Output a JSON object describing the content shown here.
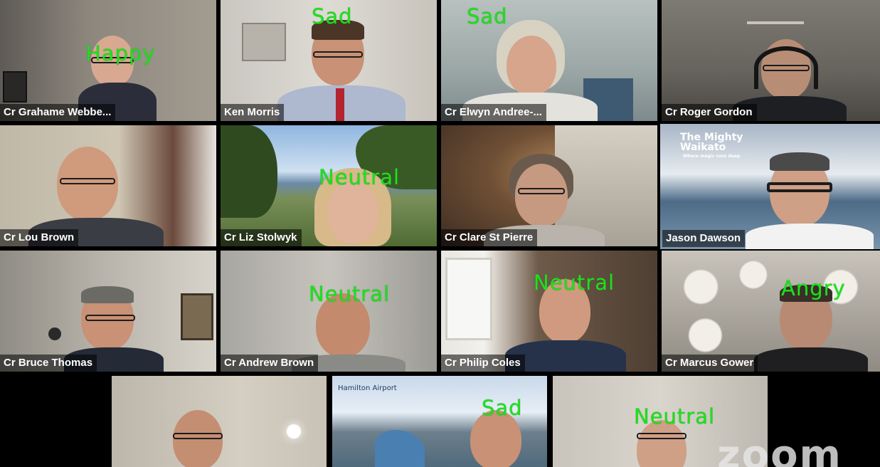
{
  "app": {
    "watermark": "zoom",
    "active_border_color": "#7ed321",
    "emotion_label_color": "#1ee01e"
  },
  "participants": [
    {
      "name": "Cr Grahame Webbe...",
      "emotion": "Happy"
    },
    {
      "name": "Ken Morris",
      "emotion": "Sad"
    },
    {
      "name": "Cr Elwyn Andree-...",
      "emotion": "Sad"
    },
    {
      "name": "Cr Roger Gordon",
      "emotion": ""
    },
    {
      "name": "Cr Lou Brown",
      "emotion": ""
    },
    {
      "name": "Cr Liz Stolwyk",
      "emotion": "Neutral"
    },
    {
      "name": "Cr Clare St Pierre",
      "emotion": ""
    },
    {
      "name": "Jason Dawson",
      "emotion": "",
      "active_speaker": true,
      "background_text": {
        "title": "The Mighty Waikato",
        "tagline": "Where magic runs deep"
      }
    },
    {
      "name": "Cr Bruce Thomas",
      "emotion": ""
    },
    {
      "name": "Cr Andrew Brown",
      "emotion": "Neutral"
    },
    {
      "name": "Cr Philip Coles",
      "emotion": "Neutral"
    },
    {
      "name": "Cr Marcus Gower",
      "emotion": "Angry"
    },
    {
      "name": "",
      "emotion": ""
    },
    {
      "name": "",
      "emotion": "Sad",
      "background_text": {
        "logo": "Hamilton Airport"
      }
    },
    {
      "name": "",
      "emotion": "Neutral"
    }
  ]
}
